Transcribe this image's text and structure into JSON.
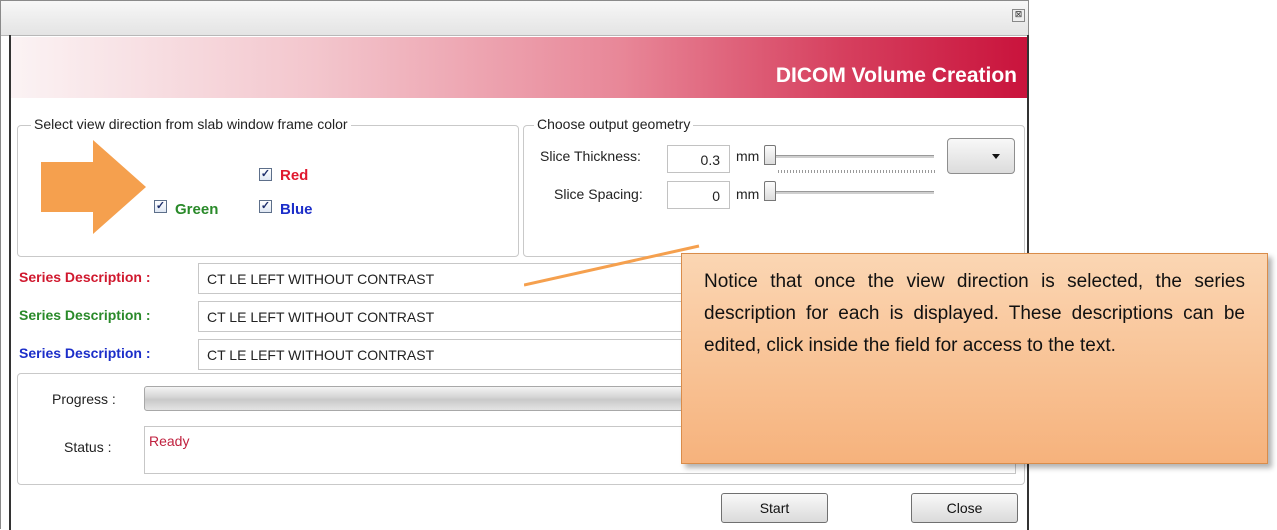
{
  "window": {
    "close_glyph": "⊠",
    "title": "DICOM Volume Creation"
  },
  "view_direction": {
    "legend": "Select view direction from slab window frame color",
    "checkboxes": [
      {
        "label": "Red",
        "checked": true,
        "color": "#e0182e"
      },
      {
        "label": "Green",
        "checked": true,
        "color": "#2a8a2a"
      },
      {
        "label": "Blue",
        "checked": true,
        "color": "#1c2ec9"
      }
    ],
    "arrow_color": "#f5a04e"
  },
  "geometry": {
    "legend": "Choose output geometry",
    "slice_thickness": {
      "label": "Slice Thickness:",
      "value": "0.3",
      "unit": "mm"
    },
    "slice_spacing": {
      "label": "Slice Spacing:",
      "value": "0",
      "unit": "mm"
    }
  },
  "series": [
    {
      "label": "Series Description :",
      "value": "CT LE LEFT WITHOUT CONTRAST",
      "color": "#d0182e"
    },
    {
      "label": "Series Description :",
      "value": "CT LE LEFT WITHOUT CONTRAST",
      "color": "#2a8a2a"
    },
    {
      "label": "Series Description :",
      "value": "CT LE LEFT WITHOUT CONTRAST",
      "color": "#1c2ec9"
    }
  ],
  "progress": {
    "label": "Progress :",
    "value": 0
  },
  "status": {
    "label": "Status :",
    "value": "Ready"
  },
  "buttons": {
    "start": "Start",
    "close": "Close"
  },
  "callout": {
    "text": "Notice that once the view direction is selected, the series description for each is displayed.  These descriptions can be edited, click inside the field for access to the text."
  }
}
